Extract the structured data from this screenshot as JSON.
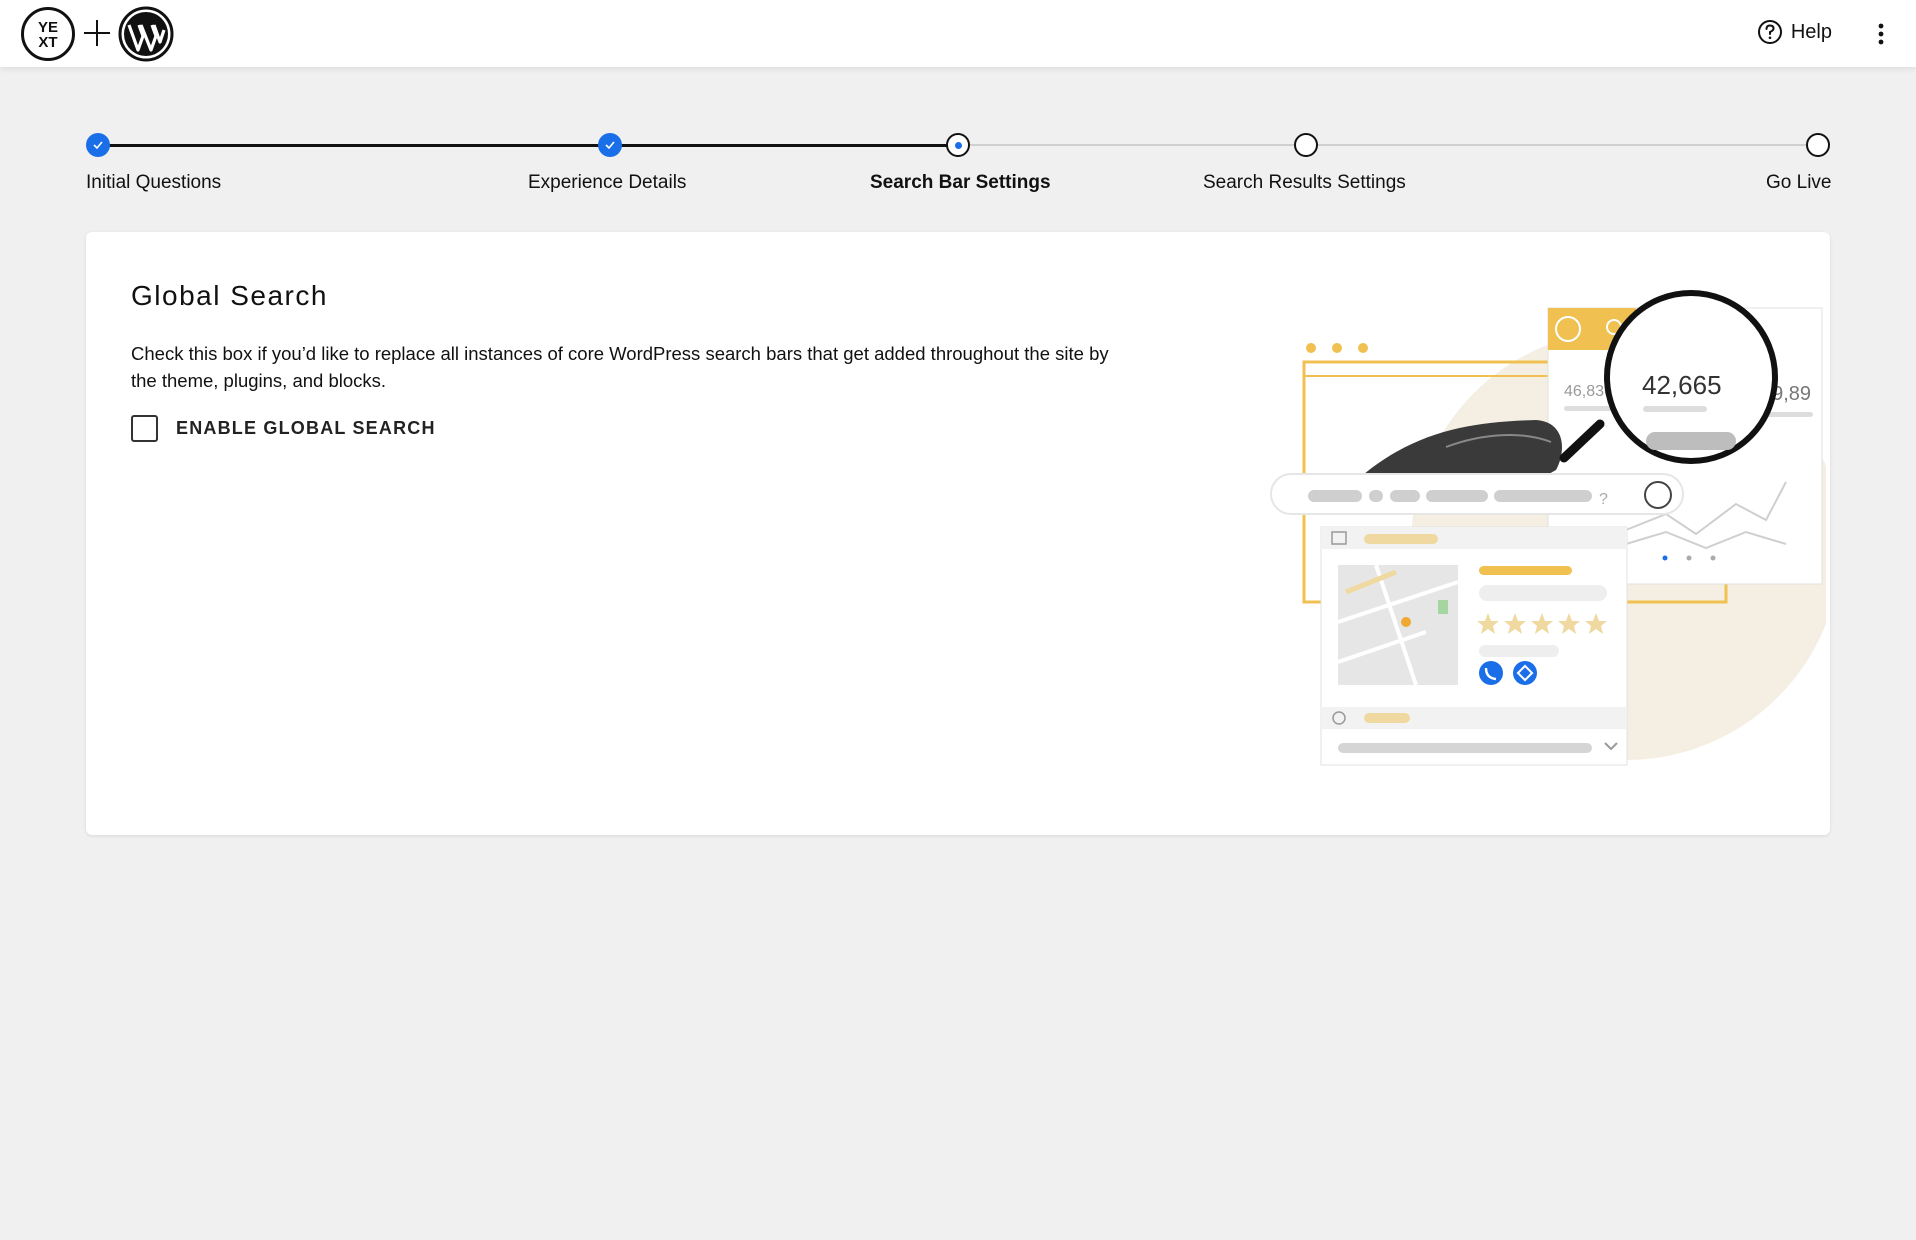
{
  "header": {
    "logo_yext_text_top": "YE",
    "logo_yext_text_bottom": "XT",
    "help_label": "Help"
  },
  "stepper": {
    "steps": [
      {
        "label": "Initial Questions",
        "state": "done"
      },
      {
        "label": "Experience Details",
        "state": "done"
      },
      {
        "label": "Search Bar Settings",
        "state": "current"
      },
      {
        "label": "Search Results Settings",
        "state": "todo"
      },
      {
        "label": "Go Live",
        "state": "todo"
      }
    ]
  },
  "card": {
    "title": "Global Search",
    "description": "Check this box if you’d like to replace all instances of core WordPress search bars that get added throughout the site by the theme, plugins, and blocks.",
    "checkbox_label": "ENABLE GLOBAL SEARCH",
    "checkbox_checked": false
  },
  "illustration": {
    "stat_left": "46,836",
    "stat_center": "42,665",
    "stat_right": "19,89",
    "search_suffix": "?",
    "rating_stars": 5
  },
  "colors": {
    "accent_blue": "#1a6fe8",
    "illustration_yellow": "#f0c050",
    "background": "#f0f0f0"
  }
}
